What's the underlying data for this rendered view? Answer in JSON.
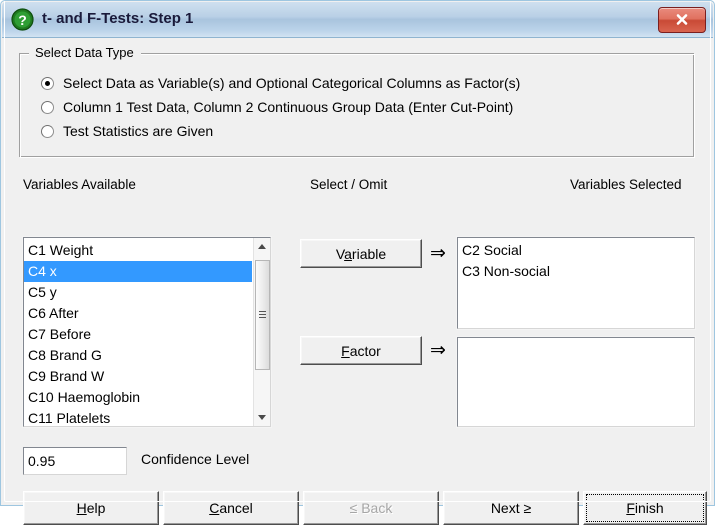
{
  "window": {
    "title": "t- and F-Tests: Step 1",
    "help_icon": "green-question-icon",
    "close_label": "close-icon",
    "titlebar_color": "#b9d0e6",
    "close_color": "#c94a36"
  },
  "group": {
    "legend": "Select Data Type",
    "options": [
      {
        "label": "Select Data as Variable(s) and Optional Categorical Columns as Factor(s)",
        "checked": true
      },
      {
        "label": "Column 1 Test Data, Column 2 Continuous Group Data (Enter Cut-Point)",
        "checked": false
      },
      {
        "label": "Test Statistics are Given",
        "checked": false
      }
    ]
  },
  "captions": {
    "available": "Variables Available",
    "select_omit": "Select / Omit",
    "selected": "Variables Selected"
  },
  "available_list": {
    "items": [
      {
        "label": "C1 Weight",
        "selected": false
      },
      {
        "label": "C4 x",
        "selected": true
      },
      {
        "label": "C5 y",
        "selected": false
      },
      {
        "label": "C6 After",
        "selected": false
      },
      {
        "label": "C7 Before",
        "selected": false
      },
      {
        "label": "C8 Brand G",
        "selected": false
      },
      {
        "label": "C9 Brand W",
        "selected": false
      },
      {
        "label": "C10 Haemoglobin",
        "selected": false
      },
      {
        "label": "C11 Platelets",
        "selected": false
      }
    ],
    "highlight_color": "#3399ff"
  },
  "selected_list": {
    "items": [
      {
        "label": "C2 Social"
      },
      {
        "label": "C3 Non-social"
      }
    ]
  },
  "factor_list": {
    "items": []
  },
  "transfer": {
    "variable_label": "Variable",
    "variable_accel": "a",
    "factor_label": "Factor",
    "factor_accel": "F",
    "arrow": "⇒"
  },
  "confidence": {
    "value": "0.95",
    "label": "Confidence Level"
  },
  "buttons": {
    "help": "Help",
    "cancel": "Cancel",
    "back": "≤ Back",
    "next": "Next ≥",
    "finish": "Finish",
    "back_disabled": true,
    "finish_default": true
  }
}
